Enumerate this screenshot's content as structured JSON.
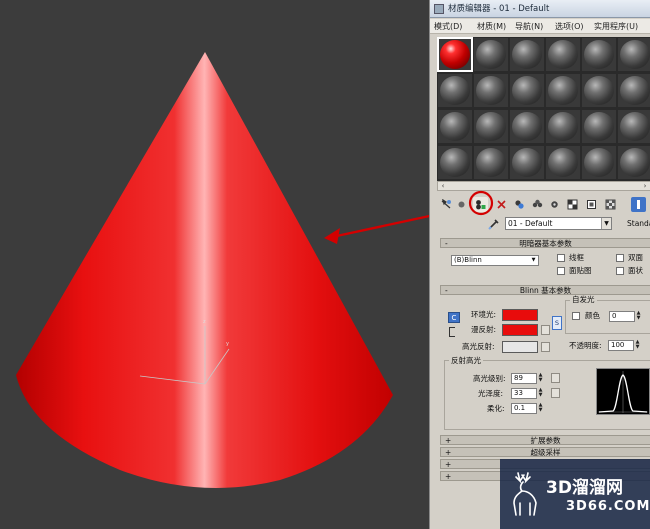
{
  "window": {
    "title": "材质编辑器 - 01 - Default"
  },
  "menu": [
    {
      "label": "模式(D)"
    },
    {
      "label": "材质(M)"
    },
    {
      "label": "导航(N)"
    },
    {
      "label": "选项(O)"
    },
    {
      "label": "实用程序(U)"
    }
  ],
  "sample_slots": {
    "rows": 4,
    "columns": 6,
    "active_slot": 1
  },
  "scroll": {
    "left": "‹",
    "right": "›"
  },
  "material": {
    "name": "01 - Default",
    "type_label": "Standa"
  },
  "shader_basic": {
    "header": "明暗器基本参数",
    "sign": "-",
    "shader": "(B)Blinn",
    "options": [
      {
        "label": "线框"
      },
      {
        "label": "双面"
      },
      {
        "label": "面贴图"
      },
      {
        "label": "面状"
      }
    ]
  },
  "blinn_basic": {
    "header": "Blinn 基本参数",
    "sign": "-",
    "ambient_label": "环境光:",
    "diffuse_label": "漫反射:",
    "specular_label": "高光反射:",
    "ambient_color": "#e80c0c",
    "diffuse_color": "#e80c0c",
    "specular_color": "#e6e6e6",
    "lock_label": "C",
    "lock_label_2": "S",
    "self_illum": {
      "title": "自发光",
      "color_label": "颜色",
      "value": "0"
    },
    "opacity": {
      "label": "不透明度:",
      "value": "100"
    }
  },
  "specular_highlights": {
    "title": "反射高光",
    "level": {
      "label": "高光级别:",
      "value": "89"
    },
    "glossiness": {
      "label": "光泽度:",
      "value": "33"
    },
    "soften": {
      "label": "柔化:",
      "value": "0.1"
    }
  },
  "collapsed_rollouts": [
    {
      "label": "扩展参数",
      "sign": "+"
    },
    {
      "label": "超级采样",
      "sign": "+"
    },
    {
      "label": "",
      "sign": "+"
    },
    {
      "label": "",
      "sign": "+"
    }
  ],
  "viewport": {
    "cone_color": "#e80c0c",
    "axis_labels": {
      "x": "x",
      "y": "y",
      "z": "z"
    }
  },
  "watermark": {
    "brand": "3D溜溜网",
    "domain": "3D66.COM"
  }
}
